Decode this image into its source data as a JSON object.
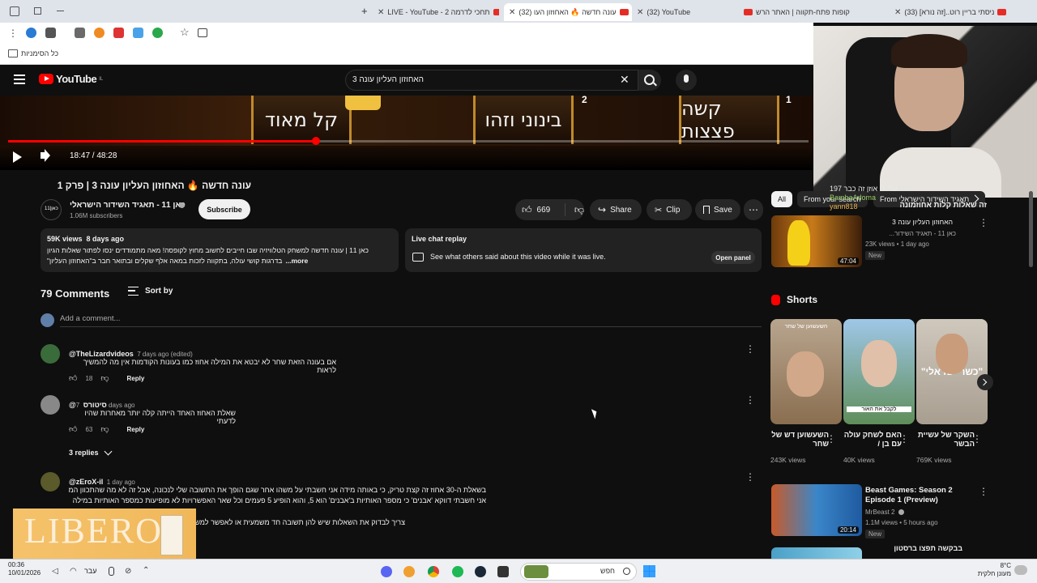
{
  "browser": {
    "tabs": [
      {
        "title": "LIVE - YouTube - 2 תחכי לדרמה"
      },
      {
        "title": "(32) עונה חדשה 🔥 האחוזון העו"
      },
      {
        "title": "(32) YouTube"
      },
      {
        "title": "קופות פתח-תקווה | האתר הרש"
      },
      {
        "title": "(33) ניסתי בריין רוט..[זה נורא]"
      }
    ],
    "bookmarks_label": "כל הסימניות"
  },
  "youtube": {
    "logo_text": "YouTube",
    "logo_region": "IL",
    "search_value": "האחוזון העליון עונה 3"
  },
  "video": {
    "panels": [
      "קל מאוד",
      "בינוני וזהו",
      "קשה פצצות"
    ],
    "panel_badges": [
      "2",
      "1"
    ],
    "progress_fraction": 0.385,
    "time": "18:47 / 48:28"
  },
  "meta": {
    "title": "עונה חדשה 🔥 האחוזון העליון עונה 3 | פרק 1",
    "channel_name": "כאן 11 - תאגיד השידור הישראלי",
    "channel_logo_text": "כאן|11",
    "subscribers": "1.06M subscribers",
    "subscribe_label": "Subscribe",
    "likes": "669",
    "share_label": "Share",
    "clip_label": "Clip",
    "save_label": "Save"
  },
  "description": {
    "stats": "59K views  8 days ago",
    "line1": "כאן 11 | עונה חדשה למשחק הטלוויזיה שבו חייבים לחשוב מחוץ לקופסה! מאה מתמודדים ינסו לפתור שאלות הגיון",
    "line2": "בדרגות קושי עולה, בתקווה לזכות במאה אלף שקלים ובתואר חבר ב\"האחוזון העליון\"",
    "more_label": "...more"
  },
  "live_chat": {
    "title": "Live chat replay",
    "text": "See what others said about this video while it was live.",
    "open_label": "Open panel"
  },
  "comments": {
    "count_label": "79 Comments",
    "sort_label": "Sort by",
    "add_placeholder": "Add a comment...",
    "items": [
      {
        "author": "@TheLizardvideos",
        "meta": "7 days ago (edited)",
        "text": "אם בעונה הזאת שחר לא יבטא את המילה אחוז כמו בעונות הקודמות אין מה להמשיך לראות",
        "likes": "18",
        "reply_label": "Reply"
      },
      {
        "author": "@סיטורס",
        "meta": "7 days ago",
        "text": "שאלת האחוז האחד הייתה קלה יותר מאחרות שהיו לדעתי",
        "likes": "63",
        "reply_label": "Reply",
        "replies_label": "3 replies"
      },
      {
        "author": "@zEroX-il",
        "meta": "1 day ago",
        "lines": [
          "בשאלת ה-30 אחוז זה קצת טריק, כי באותה מידה אני חשבתי על משהו אחר שגם הופך את התשובה שלי לנכונה, אבל זה לא מה שהתכוון המשורר",
          "אני חשבתי דווקא 'אבנים' כי מספר האותיות ב'אבנים' הוא 5, והוא הופיע 5 פעמים וכל שאר האפשרויות לא מופיעות כמספר האותיות במילה",
          "צריך לבדוק את השאלות שיש להן תשובה חד משמעית או לאפשר למשתת..."
        ]
      }
    ]
  },
  "sidebar": {
    "chips": [
      "All",
      "From your search",
      "From תאגיד השידור הישראלי"
    ],
    "top_video": {
      "title": "זה שאלות קלות אחוזמונה",
      "subtitle": "האחוזון העליון עונה 3",
      "channel": "כאן 11 - תאגיד השידור...",
      "views": "23K views • 1 day ago",
      "badge": "New",
      "duration": "47:04"
    },
    "shorts_label": "Shorts",
    "shorts": [
      {
        "title": "השעשוען דש של שחר",
        "views": "243K views",
        "overlay": "השעשוען של שחר"
      },
      {
        "title": "האם לשחק עולה עם בן /",
        "views": "40K views",
        "overlay": "לקבל את האור"
      },
      {
        "title": "השקר של עשיית הבשר",
        "views": "769K views",
        "overlay": "\"כשר ישראלי\""
      }
    ],
    "beast": {
      "title": "Beast Games: Season 2 Episode 1 (Preview)",
      "channel": "MrBeast 2",
      "views": "1.1M views • 5 hours ago",
      "badge": "New",
      "duration": "20:14"
    },
    "next_title": "בבקשה תפצו ברסטון"
  },
  "chat_overlay": {
    "line1": "עוד לי אוזן זה כבר 197",
    "line2": "BambaAdoma",
    "line3": "yann818"
  },
  "ad": {
    "text": "LIBERO"
  },
  "taskbar": {
    "date_time": "00:36",
    "date": "10/01/2026",
    "lang": "עבר",
    "search_label": "חפש",
    "weather_temp": "8°C",
    "weather_desc": "מעונן חלקית"
  },
  "colors": {
    "accent": "#ff0000",
    "background": "#0f0f0f",
    "link": "#3ea6ff"
  }
}
